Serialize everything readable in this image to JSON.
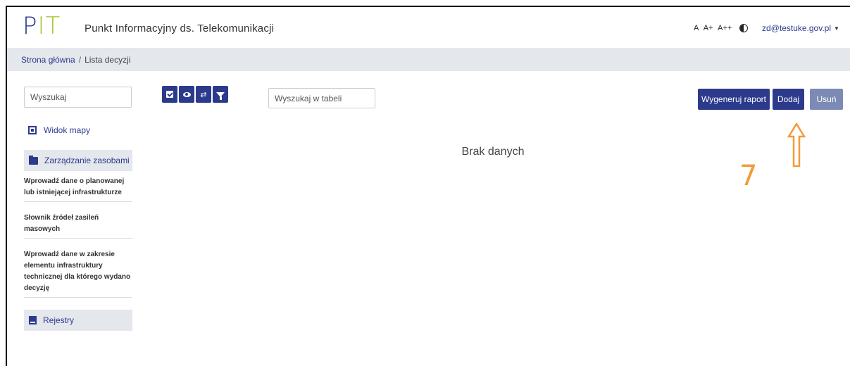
{
  "header": {
    "logo_p": "P",
    "logo_it": "IT",
    "title": "Punkt Informacyjny ds. Telekomunikacji",
    "font_sizes": [
      "A",
      "A+",
      "A++"
    ],
    "user_email": "zd@testuke.gov.pl"
  },
  "breadcrumb": {
    "home": "Strona główna",
    "separator": "/",
    "current": "Lista decyzji"
  },
  "sidebar": {
    "search_placeholder": "Wyszukaj",
    "map_view": "Widok mapy",
    "resources_section": "Zarządzanie zasobami",
    "sub_items": [
      "Wprowadź dane o planowanej lub istniejącej infrastrukturze",
      "Słownik źródeł zasileń masowych",
      "Wprowadź dane w zakresie elementu infrastruktury technicznej dla którego wydano decyzję"
    ],
    "registers_section": "Rejestry"
  },
  "toolbar": {
    "table_search_placeholder": "Wyszukaj w tabeli",
    "generate_report": "Wygeneruj raport",
    "add": "Dodaj",
    "delete": "Usuń",
    "swap_glyph": "⇄"
  },
  "main": {
    "empty_message": "Brak danych"
  },
  "annotation": {
    "step_number": "7"
  },
  "colors": {
    "brand_blue": "#2c3a8c",
    "brand_green": "#a8c83a",
    "annotation_orange": "#f39a3a",
    "disabled_button": "#7d8ab5"
  }
}
